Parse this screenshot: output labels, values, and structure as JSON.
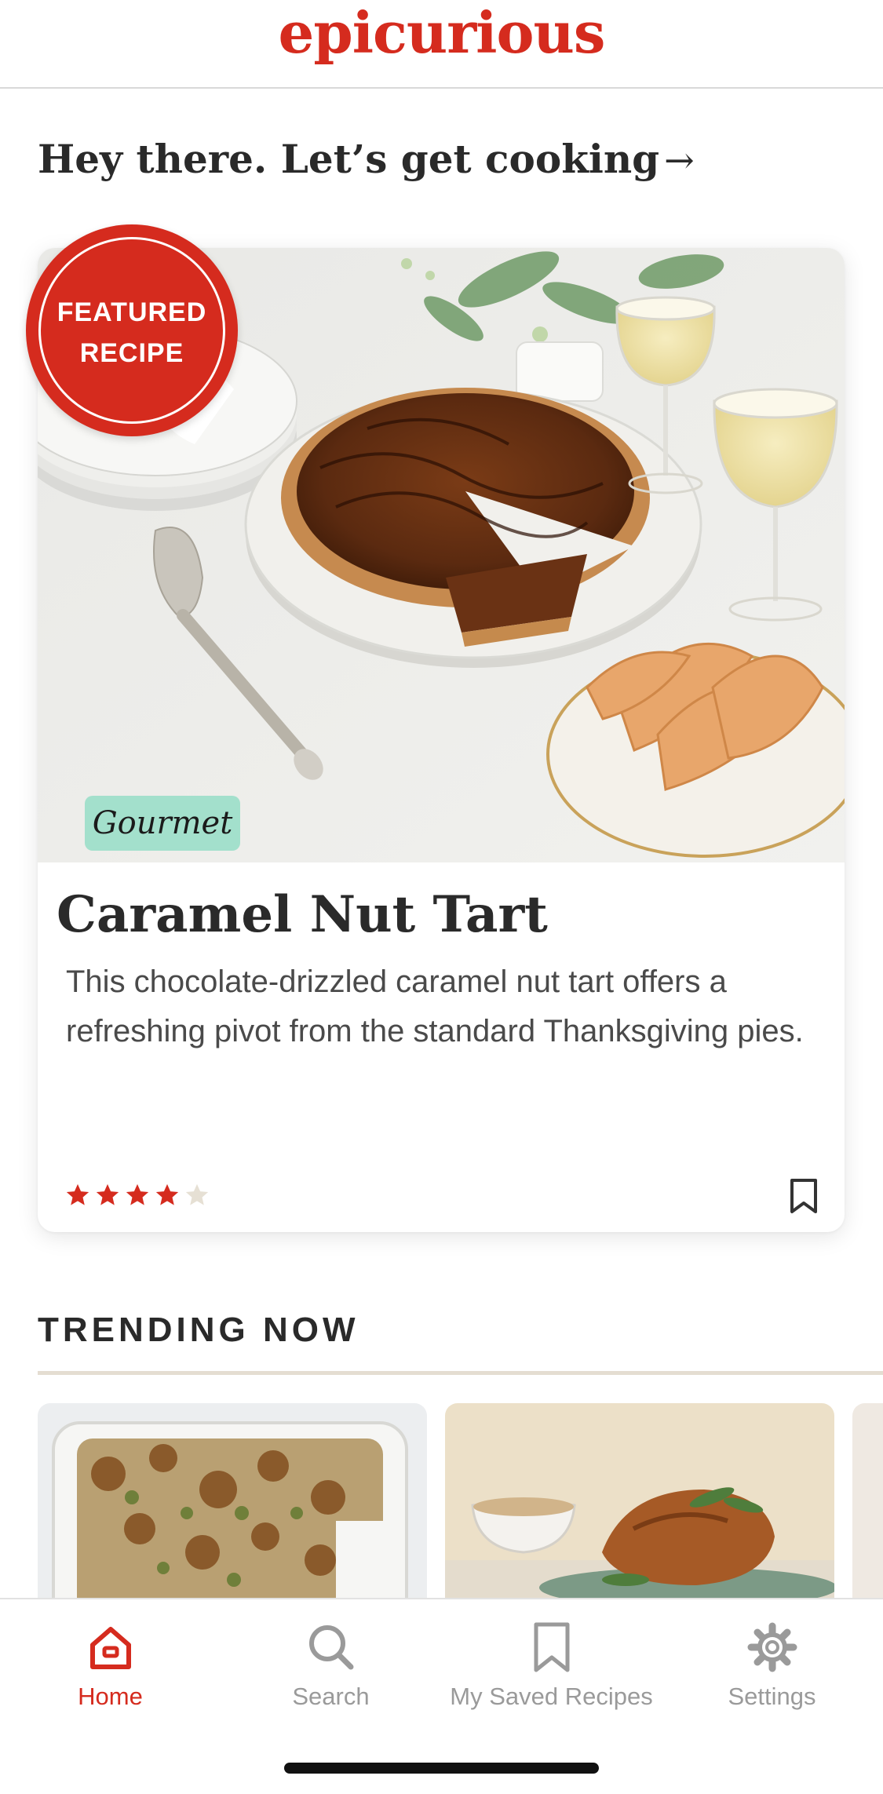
{
  "header": {
    "logo": "epicurious"
  },
  "greeting": {
    "text": "Hey there. Let’s get cooking",
    "arrow": "→"
  },
  "featured": {
    "badge_line1": "FEATURED",
    "badge_line2": "RECIPE",
    "source_tag": "Gourmet",
    "title": "Caramel Nut Tart",
    "description": "This chocolate-drizzled caramel nut tart offers a refreshing pivot from the standard Thanksgiving pies.",
    "rating": 4,
    "rating_max": 5,
    "bookmark_icon": "bookmark-icon"
  },
  "trending": {
    "title": "TRENDING NOW"
  },
  "tabbar": {
    "items": [
      {
        "label": "Home",
        "icon": "home-icon",
        "active": true
      },
      {
        "label": "Search",
        "icon": "search-icon",
        "active": false
      },
      {
        "label": "My Saved Recipes",
        "icon": "bookmark-icon",
        "active": false
      },
      {
        "label": "Settings",
        "icon": "gear-icon",
        "active": false
      }
    ]
  },
  "colors": {
    "brand": "#d52b1e",
    "inactive": "#9a9a9a",
    "tag_bg": "#a3e0cc",
    "star_empty": "#e6e0d4"
  }
}
